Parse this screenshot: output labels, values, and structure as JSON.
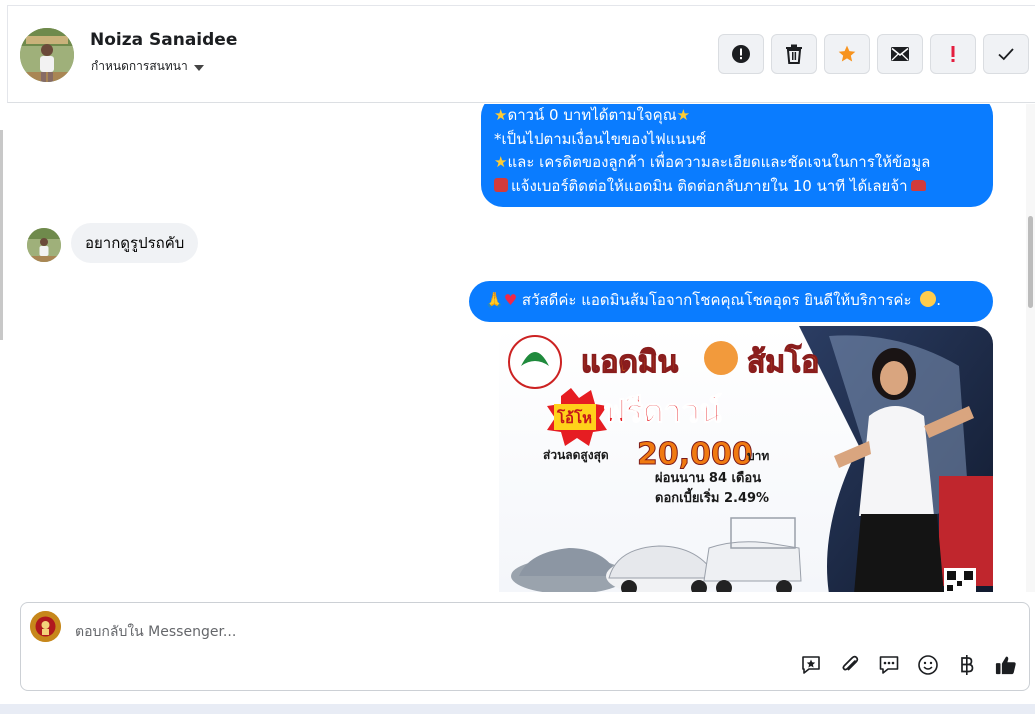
{
  "header": {
    "name": "Noiza Sanaidee",
    "assign_label": "กำหนดการสนทนา",
    "actions": [
      {
        "icon": "alert-circle-icon"
      },
      {
        "icon": "trash-icon"
      },
      {
        "icon": "star-icon",
        "color": "#f7931e"
      },
      {
        "icon": "mail-icon"
      },
      {
        "icon": "exclamation-icon",
        "color": "#e41e3f"
      },
      {
        "icon": "check-icon"
      }
    ]
  },
  "messages": [
    {
      "direction": "outgoing",
      "lines": [
        "ดาวน์ 0 บาทได้ตามใจคุณ",
        "*เป็นไปตามเงื่อนไขของไฟแนนซ์",
        "และ เครดิตของลูกค้า เพื่อความละเอียดและชัดเจนในการให้ข้อมูล",
        "แจ้งเบอร์ติดต่อให้แอดมิน ติดต่อกลับภายใน 10 นาที ได้เลยจ้า"
      ]
    },
    {
      "direction": "incoming",
      "text": "อยากดูรูปรถคับ"
    },
    {
      "direction": "outgoing",
      "text": "สวัสดีค่ะ แอดมินส้มโอจากโชคคุณโชคอุดร ยินดีให้บริการค่ะ"
    },
    {
      "direction": "outgoing",
      "type": "image",
      "ad": {
        "title": "แอดมิน",
        "title2": "ส้มโอ",
        "badge": "โอ้โห",
        "promo": "ฟรีดาวน์",
        "discount_label": "ส่วนลดสูงสุด",
        "discount_value": "20,000",
        "currency": "บาท",
        "installment": "ผ่อนนาน 84 เดือน",
        "interest": "ดอกเบี้ยเริ่ม 2.49%"
      }
    }
  ],
  "composer": {
    "placeholder": "ตอบกลับใน Messenger...",
    "tools": [
      "star-note-icon",
      "paperclip-icon",
      "saved-reply-icon",
      "emoji-icon",
      "baht-icon",
      "thumbs-up-icon"
    ]
  },
  "colors": {
    "accent": "#0a7cff",
    "star": "#f7931e",
    "alert": "#e41e3f"
  }
}
